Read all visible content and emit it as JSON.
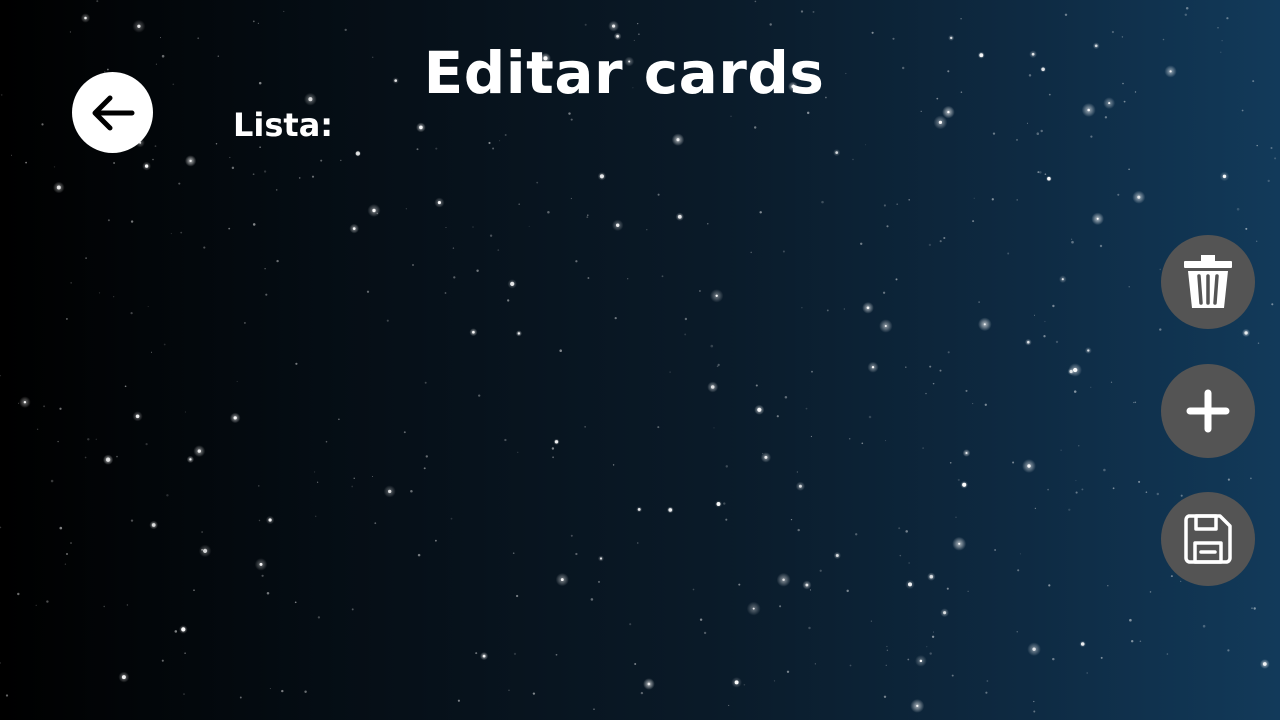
{
  "header": {
    "title": "Editar cards",
    "back_icon": "arrow-left-icon"
  },
  "main": {
    "list_label": "Lista:",
    "items": []
  },
  "actions": {
    "delete_icon": "trash-icon",
    "add_icon": "plus-icon",
    "save_icon": "floppy-disk-icon"
  },
  "colors": {
    "background_left": "#000000",
    "background_right": "#123a5a",
    "text": "#ffffff",
    "fab_background": "#545454",
    "back_button_background": "#ffffff"
  }
}
